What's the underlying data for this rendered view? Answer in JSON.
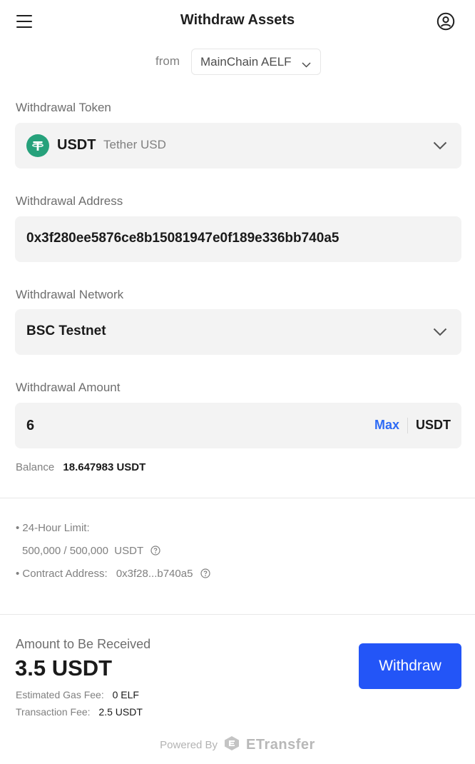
{
  "header": {
    "title": "Withdraw Assets",
    "menu_icon": "hamburger-menu-icon",
    "account_icon": "user-circle-icon"
  },
  "from": {
    "label": "from",
    "chain": "MainChain AELF"
  },
  "token": {
    "label": "Withdrawal Token",
    "symbol": "USDT",
    "name": "Tether USD",
    "icon_color": "#26a17b"
  },
  "address": {
    "label": "Withdrawal Address",
    "value": "0x3f280ee5876ce8b15081947e0f189e336bb740a5"
  },
  "network": {
    "label": "Withdrawal Network",
    "value": "BSC Testnet"
  },
  "amount": {
    "label": "Withdrawal Amount",
    "value": "6",
    "max_label": "Max",
    "unit": "USDT",
    "balance_label": "Balance",
    "balance_value": "18.647983 USDT"
  },
  "info": {
    "limit_label": "• 24-Hour Limit:",
    "limit_value": "500,000 / 500,000  USDT",
    "contract_label": "• Contract Address:",
    "contract_value": "0x3f28...b740a5"
  },
  "receive": {
    "label": "Amount to Be Received",
    "amount": "3.5 USDT",
    "gas_label": "Estimated Gas Fee:",
    "gas_value": "0 ELF",
    "tx_label": "Transaction Fee:",
    "tx_value": "2.5 USDT",
    "button": "Withdraw"
  },
  "footer": {
    "powered_by": "Powered By",
    "brand": "ETransfer"
  },
  "colors": {
    "accent": "#2355f7",
    "link": "#2e6bf5",
    "tether": "#26a17b"
  }
}
